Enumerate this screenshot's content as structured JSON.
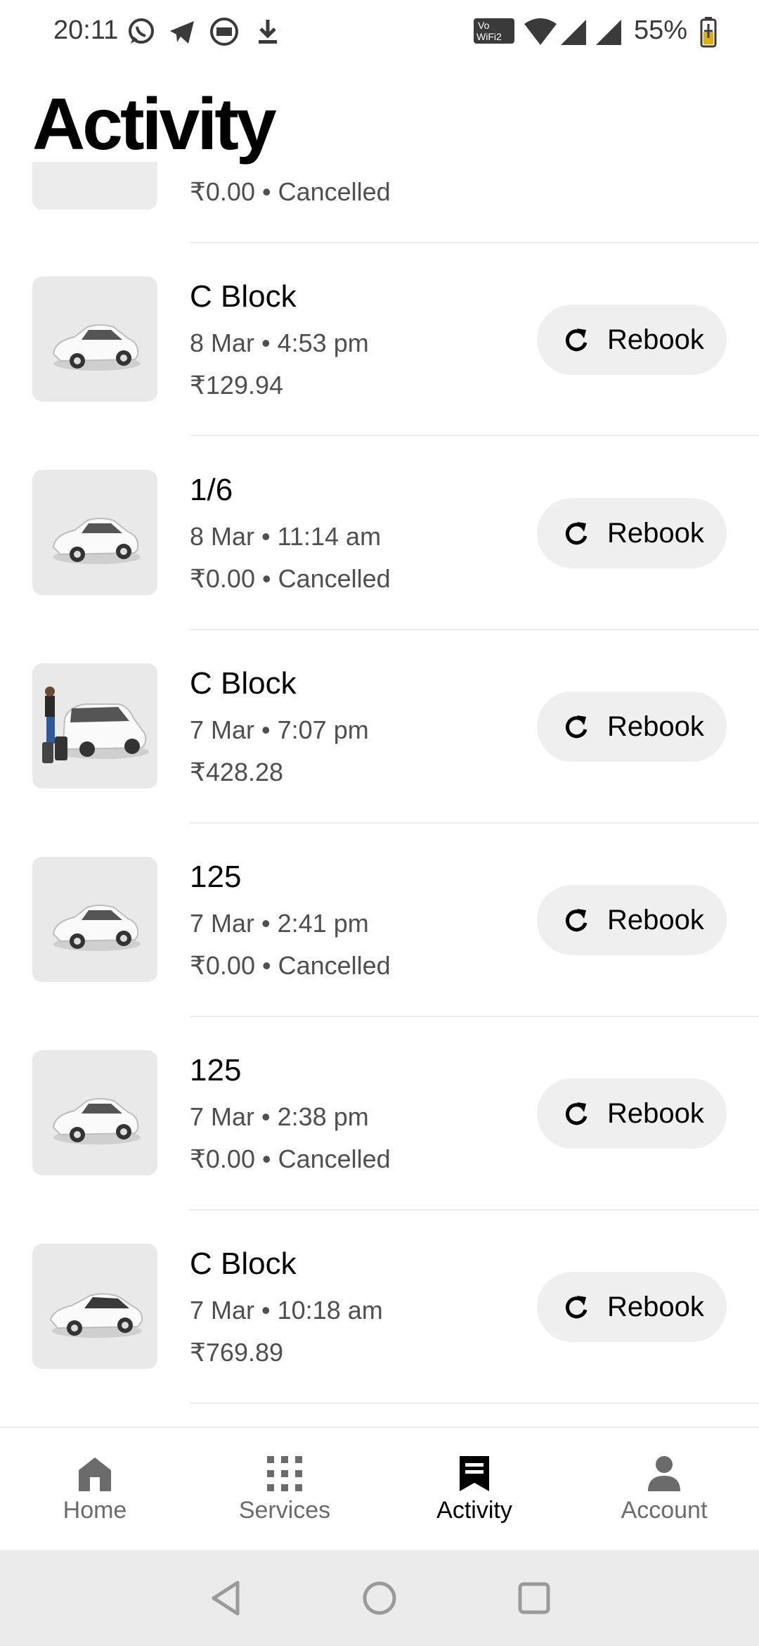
{
  "status_bar": {
    "time": "20:11",
    "battery": "55%",
    "icons": [
      "whatsapp-icon",
      "telegram-icon",
      "app-badge-icon",
      "download-icon",
      "vowifi-icon",
      "wifi-icon",
      "signal-icon",
      "signal-icon",
      "battery-charging-icon"
    ]
  },
  "header": {
    "title": "Activity"
  },
  "partial_trip": {
    "fare": "₹0.00 • Cancelled"
  },
  "trips": [
    {
      "title": "C Block",
      "date": "8 Mar • 4:53 pm",
      "fare": "₹129.94",
      "rebook": "Rebook",
      "vehicle": "car"
    },
    {
      "title": "1/6",
      "date": "8 Mar • 11:14 am",
      "fare": "₹0.00 • Cancelled",
      "rebook": "Rebook",
      "vehicle": "car"
    },
    {
      "title": "C Block",
      "date": "7 Mar • 7:07 pm",
      "fare": "₹428.28",
      "rebook": "Rebook",
      "vehicle": "suv-with-passenger"
    },
    {
      "title": "125",
      "date": "7 Mar • 2:41 pm",
      "fare": "₹0.00 • Cancelled",
      "rebook": "Rebook",
      "vehicle": "car"
    },
    {
      "title": "125",
      "date": "7 Mar • 2:38 pm",
      "fare": "₹0.00 • Cancelled",
      "rebook": "Rebook",
      "vehicle": "car"
    },
    {
      "title": "C Block",
      "date": "7 Mar • 10:18 am",
      "fare": "₹769.89",
      "rebook": "Rebook",
      "vehicle": "premium-car"
    }
  ],
  "bottom_nav": {
    "items": [
      {
        "label": "Home",
        "icon": "home-icon"
      },
      {
        "label": "Services",
        "icon": "grid-icon"
      },
      {
        "label": "Activity",
        "icon": "receipt-icon",
        "active": true
      },
      {
        "label": "Account",
        "icon": "person-icon"
      }
    ]
  },
  "system_nav": [
    "back-button",
    "home-button",
    "recents-button"
  ]
}
